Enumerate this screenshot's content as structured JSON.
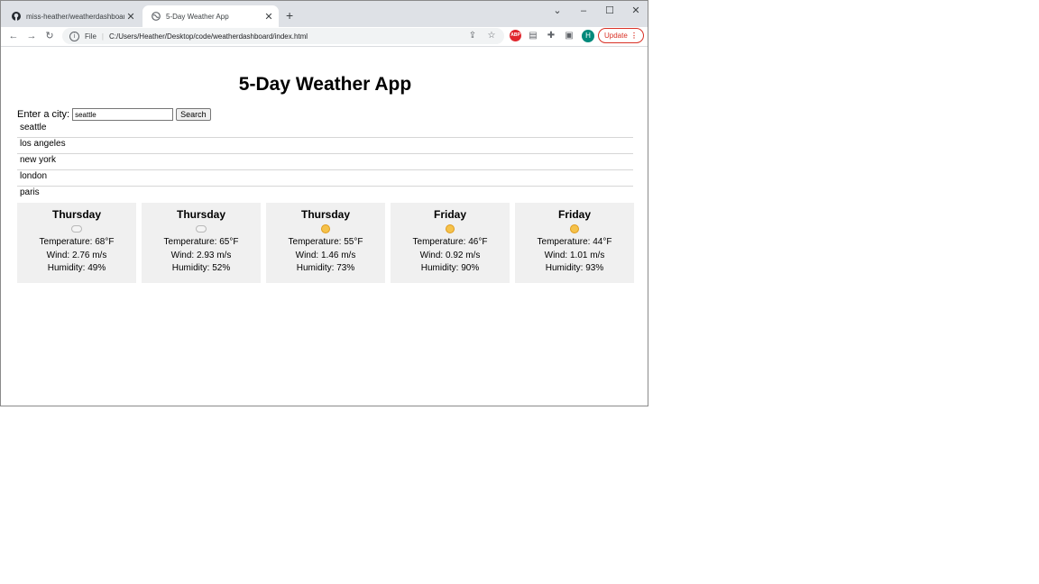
{
  "browser": {
    "tabs": [
      {
        "title": "miss-heather/weatherdashboard",
        "icon": "github-icon",
        "active": false
      },
      {
        "title": "5-Day Weather App",
        "icon": "globe-icon",
        "active": true
      }
    ],
    "address": {
      "prefix": "File",
      "url": "C:/Users/Heather/Desktop/code/weatherdashboard/index.html"
    },
    "update_label": "Update",
    "avatar_letter": "H",
    "abp_label": "ABP"
  },
  "page": {
    "title": "5-Day Weather App",
    "search": {
      "label": "Enter a city:",
      "value": "seattle",
      "button_label": "Search"
    },
    "history": [
      "seattle",
      "los angeles",
      "new york",
      "london",
      "paris"
    ],
    "forecast": [
      {
        "day": "Thursday",
        "icon": "cloud-icon",
        "temperature": "Temperature: 68°F",
        "wind": "Wind: 2.76 m/s",
        "humidity": "Humidity: 49%"
      },
      {
        "day": "Thursday",
        "icon": "cloud-icon",
        "temperature": "Temperature: 65°F",
        "wind": "Wind: 2.93 m/s",
        "humidity": "Humidity: 52%"
      },
      {
        "day": "Thursday",
        "icon": "sun-icon",
        "temperature": "Temperature: 55°F",
        "wind": "Wind: 1.46 m/s",
        "humidity": "Humidity: 73%"
      },
      {
        "day": "Friday",
        "icon": "sun-icon",
        "temperature": "Temperature: 46°F",
        "wind": "Wind: 0.92 m/s",
        "humidity": "Humidity: 90%"
      },
      {
        "day": "Friday",
        "icon": "sun-icon",
        "temperature": "Temperature: 44°F",
        "wind": "Wind: 1.01 m/s",
        "humidity": "Humidity: 93%"
      }
    ]
  },
  "colors": {
    "card_bg": "#f0f0f0",
    "sun": "#f5c24b",
    "update_red": "#d93025",
    "avatar": "#00897b"
  }
}
